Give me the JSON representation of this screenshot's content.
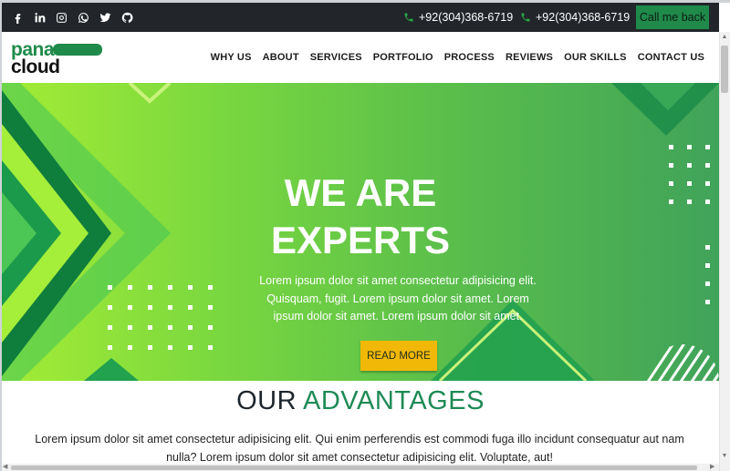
{
  "topbar": {
    "social": [
      "facebook-icon",
      "linkedin-icon",
      "instagram-icon",
      "whatsapp-icon",
      "twitter-icon",
      "github-icon"
    ],
    "phones": [
      "+92(304)368-6719",
      "+92(304)368-6719"
    ],
    "callback_label": "Call me back",
    "accent": "#27a844"
  },
  "nav": {
    "logo": {
      "line1": "pana",
      "line2": "cloud"
    },
    "items": [
      "WHY US",
      "ABOUT",
      "SERVICES",
      "PORTFOLIO",
      "PROCESS",
      "REVIEWS",
      "OUR SKILLS",
      "CONTACT US"
    ]
  },
  "hero": {
    "title_line1": "WE ARE",
    "title_line2": "EXPERTS",
    "text": "Lorem ipsum dolor sit amet consectetur adipisicing elit. Quisquam, fugit. Lorem ipsum dolor sit amet. Lorem ipsum dolor sit amet. Lorem ipsum dolor sit amet.",
    "button_label": "READ MORE",
    "button_color": "#f2b807"
  },
  "advantages": {
    "title_part1": "OUR",
    "title_part2": "ADVANTAGES",
    "text": "Lorem ipsum dolor sit amet consectetur adipisicing elit. Qui enim perferendis est commodi fuga illo incidunt consequatur aut nam nulla? Lorem ipsum dolor sit amet consectetur adipisicing elit. Voluptate, aut!",
    "accent": "#1e8a55"
  }
}
